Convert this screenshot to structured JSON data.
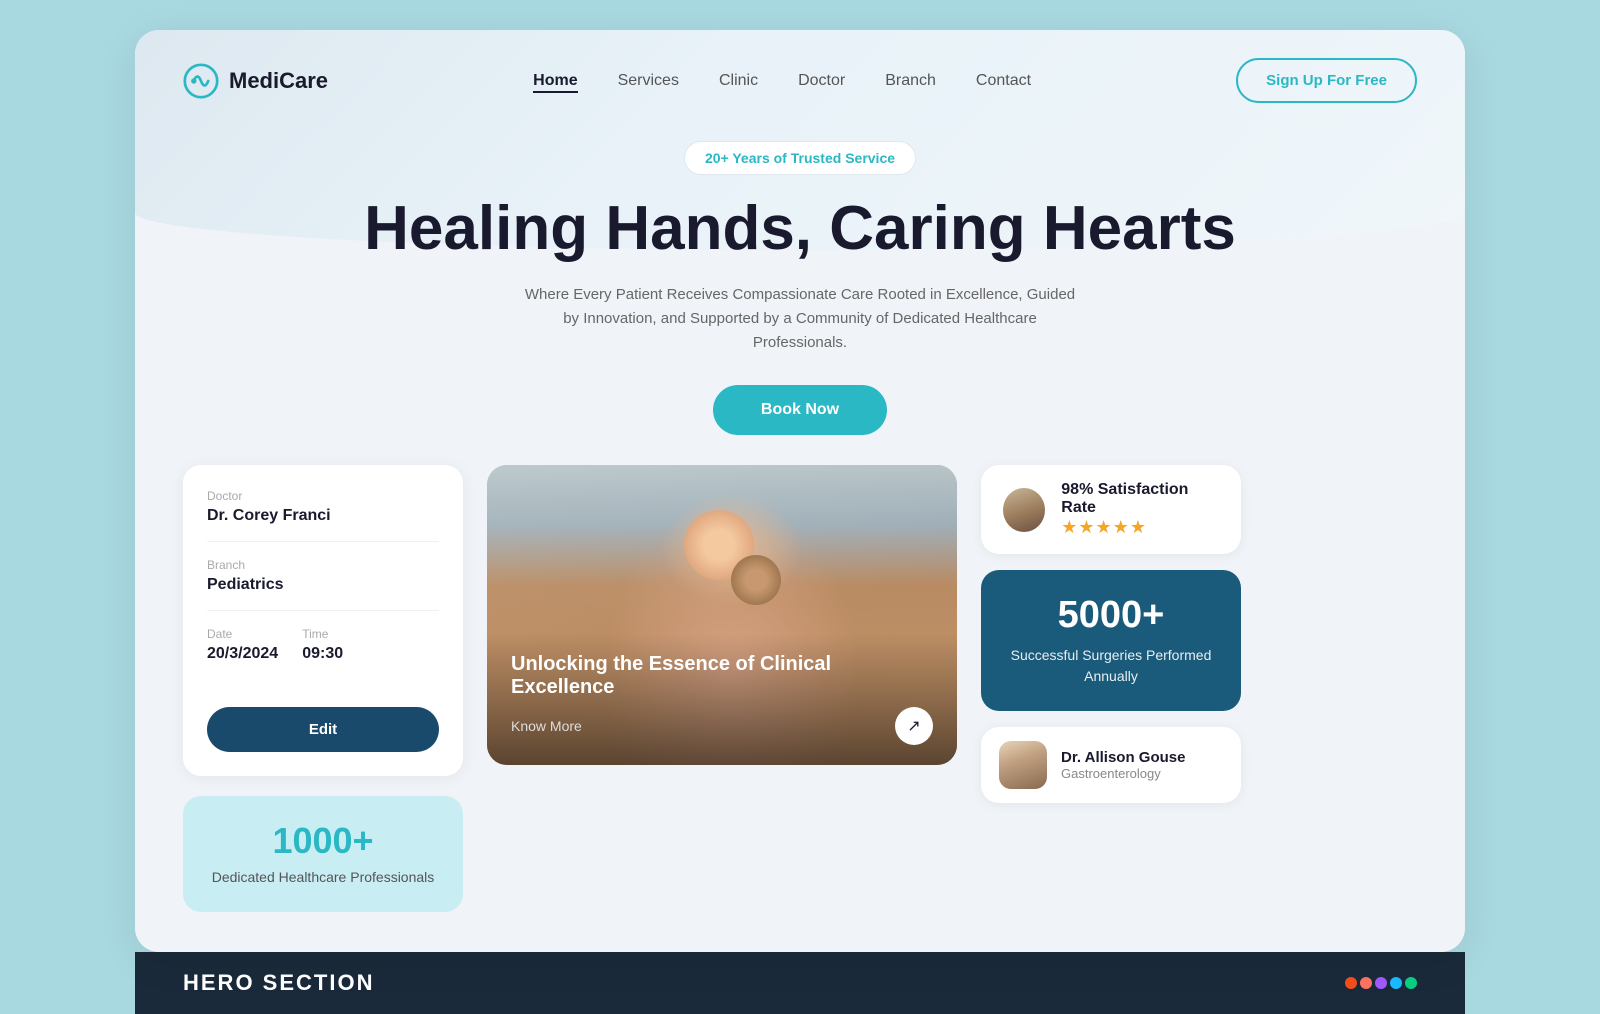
{
  "brand": {
    "name": "MediCare",
    "logo_alt": "MediCare logo"
  },
  "nav": {
    "links": [
      {
        "label": "Home",
        "active": true
      },
      {
        "label": "Services",
        "active": false
      },
      {
        "label": "Clinic",
        "active": false
      },
      {
        "label": "Doctor",
        "active": false
      },
      {
        "label": "Branch",
        "active": false
      },
      {
        "label": "Contact",
        "active": false
      }
    ],
    "cta_label": "Sign Up For Free"
  },
  "hero": {
    "badge": "20+ Years of Trusted Service",
    "title": "Healing Hands, Caring Hearts",
    "subtitle": "Where Every Patient Receives Compassionate Care Rooted in Excellence, Guided by Innovation, and Supported by a Community of Dedicated Healthcare Professionals.",
    "book_label": "Book Now"
  },
  "appointment": {
    "doctor_label": "Doctor",
    "doctor_value": "Dr. Corey Franci",
    "branch_label": "Branch",
    "branch_value": "Pediatrics",
    "date_label": "Date",
    "date_value": "20/3/2024",
    "time_label": "Time",
    "time_value": "09:30",
    "edit_label": "Edit"
  },
  "stats": {
    "number": "1000+",
    "label": "Dedicated Healthcare Professionals"
  },
  "image_card": {
    "title": "Unlocking the Essence of Clinical Excellence",
    "know_more": "Know More",
    "arrow": "↗"
  },
  "satisfaction": {
    "percentage": "98%",
    "text": "Satisfaction Rate",
    "stars": "★★★★★"
  },
  "surgeries": {
    "number": "5000+",
    "label": "Successful Surgeries Performed Annually"
  },
  "featured_doctor": {
    "name": "Dr. Allison Gouse",
    "specialty": "Gastroenterology"
  },
  "bottom": {
    "label": "HERO SECTION"
  },
  "figma": {
    "colors": [
      "#f24e1e",
      "#ff7262",
      "#a259ff",
      "#1abcfe",
      "#0acf83"
    ]
  }
}
